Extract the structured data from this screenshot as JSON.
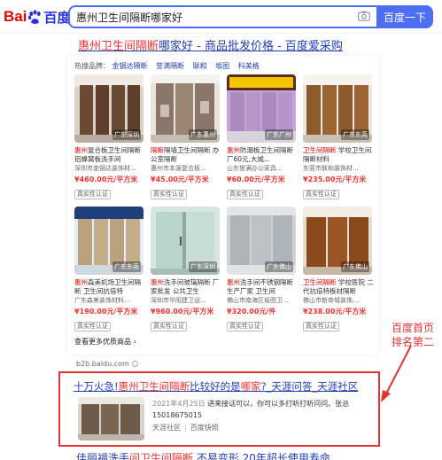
{
  "header": {
    "logo_bai": "Bai",
    "logo_du": "百度",
    "query": "惠州卫生间隔断哪家好",
    "search_button": "百度一下"
  },
  "result1": {
    "title_hl": "惠州卫生间隔断",
    "title_rest": "哪家好 - 商品批发价格 - 百度爱采购",
    "hot_label": "热搜品牌：",
    "hot_tags": [
      "金钢达隔断",
      "誉满隔断",
      "联和",
      "坂图",
      "科美格"
    ],
    "products": [
      {
        "loc": "广东深圳",
        "name_hl": "惠州",
        "name_rest": "复合板卫生间隔断 铝蜂窝板洗手间",
        "desc": "深圳市金钢达装饰材...",
        "price": "¥460.00元/平方米",
        "verify": "真实性认证"
      },
      {
        "loc": "广东惠州",
        "name_hl": "隔断",
        "name_rest": "隔墙卫生间隔断 办公室隔断",
        "desc": "惠州市本源复合板...",
        "price": "¥45.00元/平方米",
        "verify": "真实性认证"
      },
      {
        "loc": "广东广州",
        "name_hl": "惠州",
        "name_rest": "防潮板卫生间隔断 厂60元,大城...",
        "desc": "山东誉满办公家具...",
        "price": "¥60.00元/平方米",
        "verify": "真实性认证"
      },
      {
        "loc": "广东东莞",
        "name_hl": "卫生间隔断",
        "name_rest": " 学校卫生间隔断材料",
        "desc": "东莞市联和装饰材...",
        "price": "¥235.00元/平方米",
        "verify": "真实性认证"
      },
      {
        "loc": "广东东莞",
        "name_hl": "惠州",
        "name_rest": "森美机场卫生间隔断 卫生间抗倍特",
        "desc": "广东森美装饰材料...",
        "price": "¥190.00元/平方米",
        "verify": "真实性认证"
      },
      {
        "loc": "广东深圳",
        "name_hl": "惠州",
        "name_rest": "洗手间玻璃隔断 厂家批发 公共卫生",
        "desc": "深圳市华阳建卫设...",
        "price": "¥960.00元/平方米",
        "verify": "真实性认证"
      },
      {
        "loc": "广东佛山",
        "name_hl": "惠州",
        "name_rest": "洗手间不锈钢隔断 生产厂家 卫生间",
        "desc": "佛山市南海区坂图卫...",
        "price": "¥320.00元/件",
        "verify": "真实性认证"
      },
      {
        "loc": "广东佛山",
        "name_hl": "卫生间隔断",
        "name_rest": " 学校医院 二代抗倍特板材隔断",
        "desc": "佛山市新帝域装饰...",
        "price": "¥238.00元/平方米",
        "verify": "真实性认证"
      }
    ],
    "more_link": "查看更多优质商品 ›",
    "url": "b2b.baidu.com"
  },
  "result2": {
    "title_pre": "十万火急!",
    "title_hl1": "惠州卫生间隔断",
    "title_mid": "比较好的是",
    "title_hl2": "哪家",
    "title_rest": "?_天涯问答_天涯社区",
    "date": "2021年4月25日",
    "snippet": " 进来接话可以，你可以多打听打听问问。张总15018675015",
    "source": "天涯社区",
    "snapshot": "百度快照"
  },
  "annotation": {
    "line1": "百度首页",
    "line2": "排名第二",
    "color": "#e53333"
  },
  "result3": {
    "title_pre": "佳丽福洗手",
    "title_hl": "间卫生间隔断",
    "title_rest": " 不易变形 20年超长使用寿命"
  }
}
